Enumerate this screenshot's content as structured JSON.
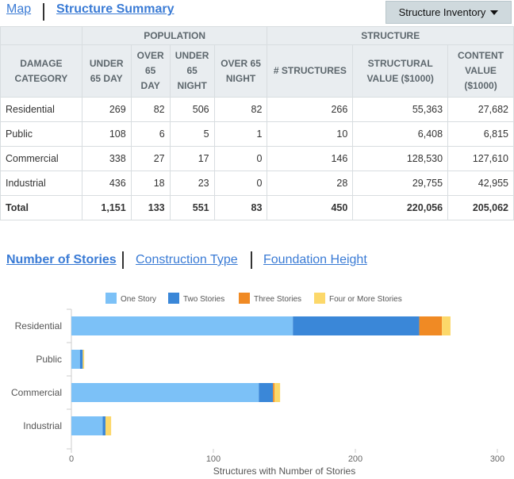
{
  "nav": {
    "map_label": "Map",
    "summary_label": "Structure Summary",
    "inventory_label": "Structure Inventory"
  },
  "table": {
    "group_headers": {
      "population": "POPULATION",
      "structure": "STRUCTURE"
    },
    "column_headers": {
      "category": "DAMAGE CATEGORY",
      "under65day": "UNDER 65 DAY",
      "over65day": "OVER 65 DAY",
      "under65night": "UNDER 65 NIGHT",
      "over65night": "OVER 65 NIGHT",
      "structures": "# STRUCTURES",
      "structural_value": "STRUCTURAL VALUE ($1000)",
      "content_value": "CONTENT VALUE ($1000)"
    },
    "rows": [
      {
        "category": "Residential",
        "under65day": "269",
        "over65day": "82",
        "under65night": "506",
        "over65night": "82",
        "structures": "266",
        "structural_value": "55,363",
        "content_value": "27,682"
      },
      {
        "category": "Public",
        "under65day": "108",
        "over65day": "6",
        "under65night": "5",
        "over65night": "1",
        "structures": "10",
        "structural_value": "6,408",
        "content_value": "6,815"
      },
      {
        "category": "Commercial",
        "under65day": "338",
        "over65day": "27",
        "under65night": "17",
        "over65night": "0",
        "structures": "146",
        "structural_value": "128,530",
        "content_value": "127,610"
      },
      {
        "category": "Industrial",
        "under65day": "436",
        "over65day": "18",
        "under65night": "23",
        "over65night": "0",
        "structures": "28",
        "structural_value": "29,755",
        "content_value": "42,955"
      }
    ],
    "total": {
      "category": "Total",
      "under65day": "1,151",
      "over65day": "133",
      "under65night": "551",
      "over65night": "83",
      "structures": "450",
      "structural_value": "220,056",
      "content_value": "205,062"
    }
  },
  "chart_tabs": {
    "stories": "Number of Stories",
    "construction": "Construction Type",
    "foundation": "Foundation Height"
  },
  "chart_data": {
    "type": "bar",
    "orientation": "horizontal",
    "stacked": true,
    "categories": [
      "Residential",
      "Public",
      "Commercial",
      "Industrial"
    ],
    "series": [
      {
        "name": "One Story",
        "color": "#7cc1f7",
        "values": [
          156,
          6,
          132,
          22
        ]
      },
      {
        "name": "Two Stories",
        "color": "#3a87d8",
        "values": [
          89,
          2,
          10,
          2
        ]
      },
      {
        "name": "Three Stories",
        "color": "#f08a24",
        "values": [
          16,
          0,
          1,
          0
        ]
      },
      {
        "name": "Four or More Stories",
        "color": "#fcd86a",
        "values": [
          6,
          1,
          4,
          4
        ]
      }
    ],
    "xlabel": "Structures with Number of Stories",
    "xlim": [
      0,
      300
    ],
    "xticks": [
      0,
      100,
      200,
      300
    ],
    "legend_position": "top",
    "grid": false
  }
}
